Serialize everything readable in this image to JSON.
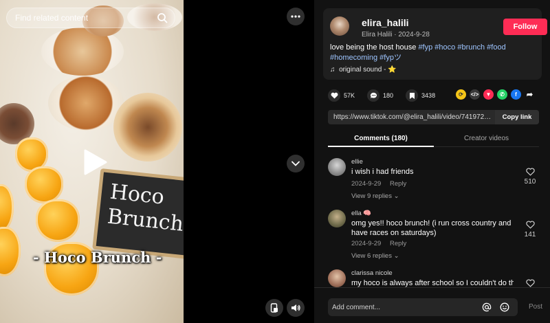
{
  "video": {
    "search_placeholder": "Find related content",
    "caption": "- Hoco Brunch -",
    "sign_line1": "Hoco",
    "sign_line2": "Brunch"
  },
  "author": {
    "username": "elira_halili",
    "display_name": "Elira Halili",
    "separator": " · ",
    "date": "2024-9-28",
    "follow_label": "Follow"
  },
  "description": {
    "text": "love being the host house ",
    "hashtags": [
      "#fyp",
      "#hoco",
      "#brunch",
      "#food",
      "#homecoming",
      "#fypツ"
    ],
    "sound": "original sound - ⭐"
  },
  "actions": {
    "likes": "57K",
    "comments": "180",
    "saves": "3438"
  },
  "share": {
    "link": "https://www.tiktok.com/@elira_halili/video/741972280...",
    "copy_label": "Copy link"
  },
  "tabs": {
    "comments": "Comments (180)",
    "creator": "Creator videos"
  },
  "comments": [
    {
      "name": "ellie",
      "text": "i wish i had friends",
      "date": "2024-9-29",
      "reply": "Reply",
      "replies": "View 9 replies",
      "likes": "510"
    },
    {
      "name": "ella 🧠",
      "text": "omg yes!! hoco brunch! (i run cross country and have races on saturdays)",
      "date": "2024-9-29",
      "reply": "Reply",
      "replies": "View 6 replies",
      "likes": "141"
    },
    {
      "name": "clarissa nicole",
      "text": "my hoco is always after school so I couldn't do this",
      "likes": ""
    }
  ],
  "composer": {
    "placeholder": "Add comment...",
    "post_label": "Post"
  },
  "colors": {
    "accent": "#fe2c55",
    "hashtag": "#9ec5ff",
    "panel_bg": "#121212"
  }
}
